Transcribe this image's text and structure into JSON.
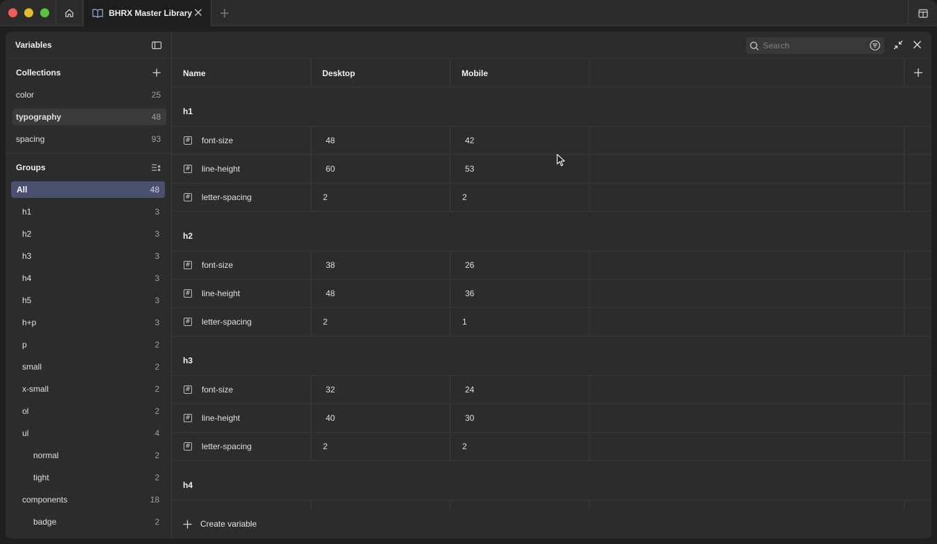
{
  "window": {
    "tab_title": "BHRX Master Library"
  },
  "sidebar": {
    "title": "Variables",
    "collections_label": "Collections",
    "collections": [
      {
        "label": "color",
        "count": "25"
      },
      {
        "label": "typography",
        "count": "48"
      },
      {
        "label": "spacing",
        "count": "93"
      }
    ],
    "groups_label": "Groups",
    "groups": [
      {
        "label": "All",
        "count": "48"
      },
      {
        "label": "h1",
        "count": "3"
      },
      {
        "label": "h2",
        "count": "3"
      },
      {
        "label": "h3",
        "count": "3"
      },
      {
        "label": "h4",
        "count": "3"
      },
      {
        "label": "h5",
        "count": "3"
      },
      {
        "label": "h+p",
        "count": "3"
      },
      {
        "label": "p",
        "count": "2"
      },
      {
        "label": "small",
        "count": "2"
      },
      {
        "label": "x-small",
        "count": "2"
      },
      {
        "label": "ol",
        "count": "2"
      },
      {
        "label": "ul",
        "count": "4"
      },
      {
        "label": "normal",
        "count": "2"
      },
      {
        "label": "tight",
        "count": "2"
      },
      {
        "label": "components",
        "count": "18"
      },
      {
        "label": "badge",
        "count": "2"
      }
    ]
  },
  "search": {
    "placeholder": "Search"
  },
  "table": {
    "columns": [
      "Name",
      "Desktop",
      "Mobile"
    ],
    "groups": [
      {
        "label": "h1",
        "rows": [
          {
            "name": "font-size",
            "desktop": "48",
            "mobile": "42"
          },
          {
            "name": "line-height",
            "desktop": "60",
            "mobile": "53"
          },
          {
            "name": "letter-spacing",
            "desktop": "2",
            "mobile": "2"
          }
        ]
      },
      {
        "label": "h2",
        "rows": [
          {
            "name": "font-size",
            "desktop": "38",
            "mobile": "26"
          },
          {
            "name": "line-height",
            "desktop": "48",
            "mobile": "36"
          },
          {
            "name": "letter-spacing",
            "desktop": "2",
            "mobile": "1"
          }
        ]
      },
      {
        "label": "h3",
        "rows": [
          {
            "name": "font-size",
            "desktop": "32",
            "mobile": "24"
          },
          {
            "name": "line-height",
            "desktop": "40",
            "mobile": "30"
          },
          {
            "name": "letter-spacing",
            "desktop": "2",
            "mobile": "2"
          }
        ]
      },
      {
        "label": "h4",
        "rows": []
      }
    ]
  },
  "footer": {
    "create_label": "Create variable"
  }
}
